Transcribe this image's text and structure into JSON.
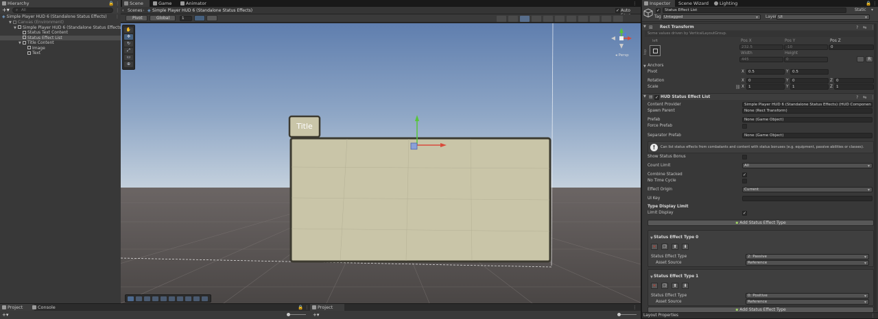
{
  "hierarchy": {
    "tab": "Hierarchy",
    "search_placeholder": "All",
    "scene_root": "Simple Player HUD 6 (Standalone Status Effects)",
    "items": [
      {
        "label": "Canvas (Environment)",
        "indent": 1,
        "dim": true,
        "expanded": true
      },
      {
        "label": "Simple Player HUD 6 (Standalone Status Effects)",
        "indent": 2,
        "expanded": true
      },
      {
        "label": "Status Text Content",
        "indent": 3
      },
      {
        "label": "Status Effect List",
        "indent": 3,
        "selected": true
      },
      {
        "label": "Title Content",
        "indent": 3,
        "expanded": true
      },
      {
        "label": "Image",
        "indent": 4
      },
      {
        "label": "Text",
        "indent": 4
      }
    ]
  },
  "center_tabs": [
    "Scene",
    "Game",
    "Animator"
  ],
  "scene": {
    "breadcrumb_root": "Scenes",
    "breadcrumb_prefab": "Simple Player HUD 6 (Standalone Status Effects)",
    "auto_save": "Auto Save",
    "pivot": "Pivot",
    "global": "Global",
    "grid_snap": "1",
    "title_label": "Title",
    "persp_label": "Persp"
  },
  "inspector": {
    "tabs": [
      "Inspector",
      "Scene Wizard",
      "Lighting"
    ],
    "object_name": "Status Effect List",
    "static_label": "Static",
    "tag_label": "Tag",
    "tag_value": "Untagged",
    "layer_label": "Layer",
    "layer_value": "UI",
    "rect_transform": {
      "title": "Rect Transform",
      "note": "Some values driven by VerticalLayoutGroup.",
      "anchor_preset_top": "left",
      "anchor_preset_side": "top",
      "pos_x_label": "Pos X",
      "pos_x": "232.5",
      "pos_y_label": "Pos Y",
      "pos_y": "-10",
      "pos_z_label": "Pos Z",
      "pos_z": "0",
      "width_label": "Width",
      "width": "445",
      "height_label": "Height",
      "height": "0",
      "anchors_label": "Anchors",
      "pivot_label": "Pivot",
      "pivot_x": "0.5",
      "pivot_y": "0.5",
      "rotation_label": "Rotation",
      "rot_x": "0",
      "rot_y": "0",
      "rot_z": "0",
      "scale_label": "Scale",
      "scale_x": "1",
      "scale_y": "1",
      "scale_z": "1",
      "r_button": "R"
    },
    "hud_component": {
      "title": "HUD Status Effect List",
      "content_provider_label": "Content Provider",
      "content_provider_value": "Simple Player HUD 6 (Standalone Status Effects) (HUD Componen",
      "spawn_parent_label": "Spawn Parent",
      "spawn_parent_value": "None (Rect Transform)",
      "prefab_label": "Prefab",
      "prefab_value": "None (Game Object)",
      "force_prefab_label": "Force Prefab",
      "separator_prefab_label": "Separator Prefab",
      "separator_prefab_value": "None (Game Object)",
      "info_text": "Can list status effects from combatants and content with status bonuses (e.g. equipment, passive abilities or classes).",
      "show_status_bonus_label": "Show Status Bonus",
      "count_limit_label": "Count Limit",
      "count_limit_value": "All",
      "combine_stacked_label": "Combine Stacked",
      "no_time_cycle_label": "No Time Cycle",
      "effect_origin_label": "Effect Origin",
      "effect_origin_value": "Current",
      "ui_key_label": "UI Key",
      "type_display_limit_label": "Type Display Limit",
      "limit_display_label": "Limit Display",
      "add_button": "Add Status Effect Type",
      "types": [
        {
          "title": "Status Effect Type 0",
          "type_label": "Status Effect Type",
          "type_value": "2: Passive",
          "asset_label": "Asset Source",
          "asset_value": "Reference"
        },
        {
          "title": "Status Effect Type 1",
          "type_label": "Status Effect Type",
          "type_value": "0: Positive",
          "asset_label": "Asset Source",
          "asset_value": "Reference"
        }
      ]
    },
    "layout_properties": "Layout Properties"
  },
  "bottom": {
    "project_tab": "Project",
    "console_tab": "Console",
    "project_tab_2": "Project"
  },
  "colors": {
    "panel_bg": "#383838",
    "sky_top": "#5f7eae",
    "sky_bottom": "#b9c9d8",
    "ground": "#5a5554",
    "hud_panel": "#c9c5a8",
    "hud_border": "#3c3a30"
  }
}
